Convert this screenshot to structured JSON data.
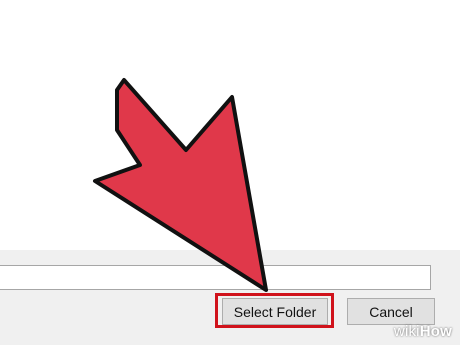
{
  "dialog": {
    "path_value": "",
    "select_folder_label": "Select Folder",
    "cancel_label": "Cancel"
  },
  "annotation": {
    "arrow_icon": "pointer-arrow-icon",
    "arrow_color": "#e0384a",
    "highlight_color": "#d0121b"
  },
  "watermark": {
    "prefix": "wiki",
    "suffix": "How"
  }
}
